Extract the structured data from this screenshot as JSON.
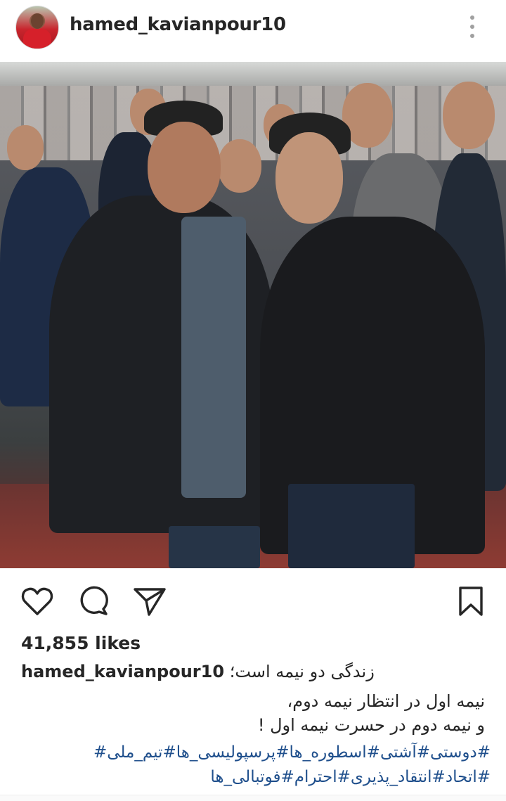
{
  "post": {
    "username": "hamed_kavianpour10",
    "likes": "41,855 likes",
    "caption_user": "hamed_kavianpour10",
    "caption_first": "زندگی دو نیمه است؛",
    "caption_lines": [
      "نیمه اول در انتظار نیمه دوم،",
      "و نیمه دوم در حسرت نیمه اول !"
    ],
    "hashtag_lines": [
      "#دوستی#آشتی#اسطوره_ها#پرسپولیسی_ها#تیم_ملی#",
      "#اتحاد#انتقاد_پذیری#احترام#فوتبالی_ها"
    ]
  },
  "icons": {
    "more": "more-vertical-icon",
    "like": "heart-icon",
    "comment": "comment-icon",
    "share": "paper-plane-icon",
    "save": "bookmark-icon"
  },
  "colors": {
    "text": "#262626",
    "hashtag": "#1f4f8c",
    "secondary": "#a0a0a0"
  }
}
